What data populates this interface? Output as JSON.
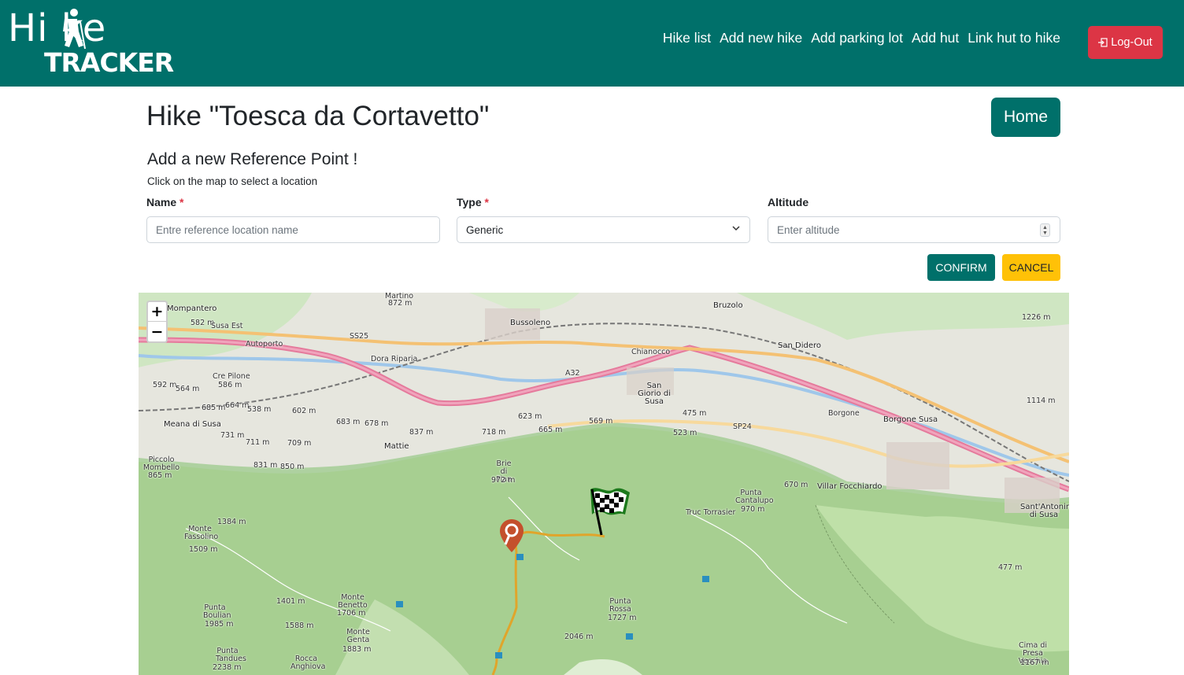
{
  "brand": {
    "hike": "Hi ke",
    "tracker": "TRACKER"
  },
  "nav": {
    "links": [
      "Hike list",
      "Add new hike",
      "Add parking lot",
      "Add hut",
      "Link hut to hike"
    ],
    "logout": "Log-Out"
  },
  "header": {
    "title": "Hike \"Toesca da Cortavetto\"",
    "home": "Home"
  },
  "form": {
    "section_title": "Add a new Reference Point !",
    "hint": "Click on the map to select a location",
    "name": {
      "label": "Name",
      "required": "*",
      "placeholder": "Entre reference location name"
    },
    "type": {
      "label": "Type",
      "required": "*",
      "value": "Generic"
    },
    "altitude": {
      "label": "Altitude",
      "placeholder": "Enter altitude"
    },
    "confirm": "CONFIRM",
    "cancel": "CANCEL"
  },
  "map": {
    "zoom_in": "+",
    "zoom_out": "−",
    "places": [
      "Mompantero",
      "582 m",
      "Susa Est",
      "Martino",
      "872 m",
      "Bussoleno",
      "Bruzolo",
      "1226 m",
      "San Didero",
      "Chianocco",
      "San Giorio di Susa",
      "Cre Pilone",
      "586 m",
      "592 m",
      "564 m",
      "Meana di Susa",
      "731 m",
      "Mattie",
      "Piccolo Mombello",
      "865 m",
      "Brie di Pian",
      "972 m",
      "1384 m",
      "Monte Fassolino",
      "1509 m",
      "Villar Focchiardo",
      "Borgone Susa",
      "Truc Torrasier",
      "Punta Cantalupo",
      "970 m",
      "Sant'Antonino di Susa",
      "Punta Boulian",
      "1985 m",
      "1401 m",
      "1588 m",
      "Monte Benetto",
      "1706 m",
      "Monte Genta",
      "1883 m",
      "Punta Rossa",
      "1727 m",
      "2046 m",
      "Punta Tandues",
      "2238 m",
      "Rocca Anghiova",
      "Cima di Presa Vecchia",
      "1167 m",
      "477 m",
      "670 m",
      "1114 m",
      "623 m",
      "665 m",
      "569 m",
      "475 m",
      "523 m",
      "683 m",
      "678 m",
      "837 m",
      "718 m",
      "711 m",
      "709 m",
      "831 m",
      "850 m",
      "664 m",
      "538 m",
      "602 m",
      "685 m",
      "Autoporto",
      "A32",
      "SS25",
      "SP24",
      "Borgone",
      "Dora Riparia"
    ]
  }
}
